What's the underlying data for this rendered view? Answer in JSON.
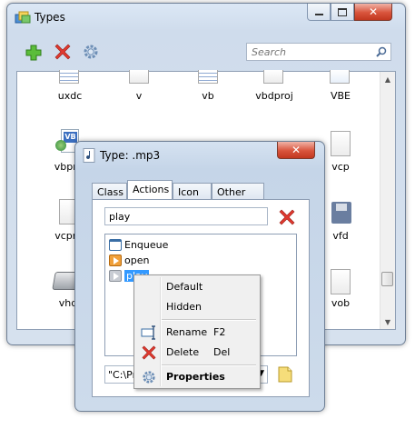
{
  "types_window": {
    "title": "Types",
    "search_placeholder": "Search",
    "toolbar": {
      "add_icon": "plus-icon",
      "delete_icon": "red-x-icon",
      "settings_icon": "gear-icon"
    },
    "files": [
      {
        "label": "uxdc"
      },
      {
        "label": "v"
      },
      {
        "label": "vb"
      },
      {
        "label": "vbdproj"
      },
      {
        "label": "VBE"
      },
      {
        "label": "vbproj"
      },
      {
        "label": "vcp"
      },
      {
        "label": "vcproj"
      },
      {
        "label": "vfd"
      },
      {
        "label": "vhd"
      },
      {
        "label": "vob"
      }
    ]
  },
  "dialog": {
    "title": "Type: .mp3",
    "close_label": "X",
    "tabs": [
      {
        "label": "Class",
        "active": false
      },
      {
        "label": "Actions",
        "active": true
      },
      {
        "label": "Icon",
        "active": false
      },
      {
        "label": "Other",
        "active": false
      }
    ],
    "action_name_value": "play",
    "actions": [
      {
        "label": "Enqueue",
        "icon": "window-icon"
      },
      {
        "label": "open",
        "icon": "orange-play-icon"
      },
      {
        "label": "play",
        "icon": "gray-play-icon",
        "selected": true
      }
    ],
    "command_value": "\"C:\\Pro",
    "command_arrow": "▼"
  },
  "context_menu": {
    "items": [
      {
        "label": "Default",
        "key": ""
      },
      {
        "label": "Hidden",
        "key": ""
      },
      {
        "label": "Rename",
        "key": "F2",
        "icon": "rename-icon"
      },
      {
        "label": "Delete",
        "key": "Del",
        "icon": "red-x-icon"
      },
      {
        "label": "Properties",
        "key": "",
        "icon": "gear-icon",
        "bold": true
      }
    ]
  },
  "colors": {
    "title_gradient_top": "#dbe7f5",
    "close_button": "#d9543c",
    "selection": "#3399ff",
    "delete_red": "#d1302a"
  }
}
